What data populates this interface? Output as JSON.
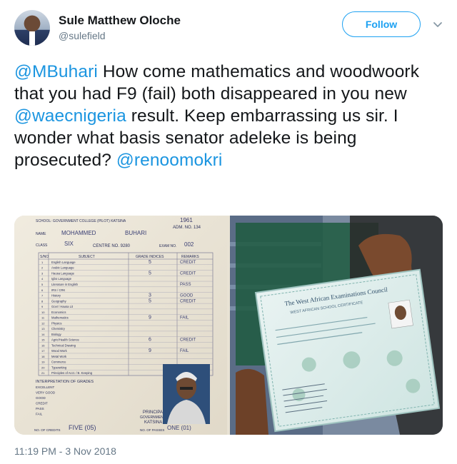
{
  "author": {
    "display_name": "Sule Matthew Oloche",
    "handle": "@sulefield"
  },
  "follow_label": "Follow",
  "tweet": {
    "segments": [
      {
        "text": "@MBuhari",
        "mention": true
      },
      {
        "text": " How come mathematics and woodwoork that you had F9 (fail) both disappeared in you new ",
        "mention": false
      },
      {
        "text": "@waecnigeria",
        "mention": true
      },
      {
        "text": " result. Keep embarrassing us sir. I wonder what basis senator adeleke is being prosecuted? ",
        "mention": false
      },
      {
        "text": "@renoomokri",
        "mention": true
      }
    ]
  },
  "media": {
    "left_doc": {
      "school_line": "SCHOOL: GOVERNMENT COLLEGE (PILOT) KATSINA",
      "year": "1961",
      "adm_no": "ADM. NO. 134",
      "name_label": "NAME",
      "first_name": "MOHAMMED",
      "surname": "BUHARI",
      "class_label": "CLASS",
      "class_value": "SIX",
      "centre_label": "CENTRE NO. 9280",
      "exam_label": "EXAM NO.",
      "exam_no": "002",
      "col_sn": "S/NO",
      "col_subject": "SUBJECT",
      "col_grade": "GRADE INDICES",
      "col_remarks": "REMARKS",
      "subjects": [
        {
          "n": "1",
          "s": "English Language",
          "g": "5",
          "r": "CREDIT"
        },
        {
          "n": "2",
          "s": "Arabic Language",
          "g": "",
          "r": ""
        },
        {
          "n": "3",
          "s": "Hausa Language",
          "g": "5",
          "r": "CREDIT"
        },
        {
          "n": "4",
          "s": "Igbo Language",
          "g": "",
          "r": ""
        },
        {
          "n": "5",
          "s": "Literature in English",
          "g": "",
          "r": "PASS"
        },
        {
          "n": "6",
          "s": "IRS / CRK",
          "g": "",
          "r": ""
        },
        {
          "n": "7",
          "s": "History",
          "g": "3",
          "r": "GOOD"
        },
        {
          "n": "8",
          "s": "Geography",
          "g": "5",
          "r": "CREDIT"
        },
        {
          "n": "9",
          "s": "Govt / Hausa Lit",
          "g": "",
          "r": ""
        },
        {
          "n": "10",
          "s": "Economics",
          "g": "",
          "r": ""
        },
        {
          "n": "11",
          "s": "Mathematics",
          "g": "9",
          "r": "FAIL"
        },
        {
          "n": "12",
          "s": "Physics",
          "g": "",
          "r": ""
        },
        {
          "n": "13",
          "s": "Chemistry",
          "g": "",
          "r": ""
        },
        {
          "n": "14",
          "s": "Biology",
          "g": "",
          "r": ""
        },
        {
          "n": "15",
          "s": "Agric/Health Science",
          "g": "6",
          "r": "CREDIT"
        },
        {
          "n": "16",
          "s": "Technical Drawing",
          "g": "",
          "r": ""
        },
        {
          "n": "17",
          "s": "Wood Work",
          "g": "9",
          "r": "FAIL"
        },
        {
          "n": "18",
          "s": "Metal Work",
          "g": "",
          "r": ""
        },
        {
          "n": "19",
          "s": "Commerce",
          "g": "",
          "r": ""
        },
        {
          "n": "20",
          "s": "Typewriting",
          "g": "",
          "r": ""
        },
        {
          "n": "21",
          "s": "Principles of Acct. / B. Keeping",
          "g": "",
          "r": ""
        }
      ],
      "interp_title": "INTERPRETATION OF GRADES",
      "interp_rows": [
        "EXCELLENT",
        "VERY GOOD",
        "GOOD",
        "CREDIT",
        "PASS",
        "FAIL"
      ],
      "principal": "PRINCIPAL",
      "govt_line": "GOVERNMENT",
      "katsina": "KATSINA",
      "passes_label": "NO. OF CREDITS",
      "passes_value": "FIVE (05)",
      "fails_label": "NO. OF PASSES",
      "fails_value": "ONE (01)"
    },
    "right_doc": {
      "council": "The West African Examinations Council",
      "cert": "WEST AFRICAN SCHOOL CERTIFICATE"
    }
  },
  "timestamp": "11:19 PM - 3 Nov 2018",
  "colors": {
    "link": "#1b95e0",
    "follow": "#1da1f2",
    "muted": "#657786",
    "text": "#14171a"
  }
}
